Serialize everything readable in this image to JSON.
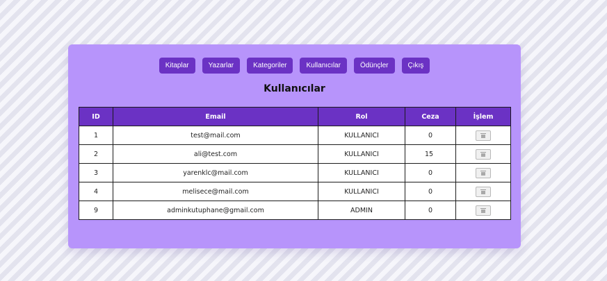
{
  "nav": {
    "buttons": [
      "Kitaplar",
      "Yazarlar",
      "Kategoriler",
      "Kullanıcılar",
      "Ödünçler",
      "Çıkış"
    ]
  },
  "page": {
    "title": "Kullanıcılar"
  },
  "table": {
    "headers": {
      "id": "ID",
      "email": "Email",
      "rol": "Rol",
      "ceza": "Ceza",
      "islem": "İşlem"
    },
    "rows": [
      {
        "id": "1",
        "email": "test@mail.com",
        "rol": "KULLANICI",
        "ceza": "0"
      },
      {
        "id": "2",
        "email": "ali@test.com",
        "rol": "KULLANICI",
        "ceza": "15"
      },
      {
        "id": "3",
        "email": "yarenklc@mail.com",
        "rol": "KULLANICI",
        "ceza": "0"
      },
      {
        "id": "4",
        "email": "melisece@mail.com",
        "rol": "KULLANICI",
        "ceza": "0"
      },
      {
        "id": "9",
        "email": "adminkutuphane@gmail.com",
        "rol": "ADMIN",
        "ceza": "0"
      }
    ],
    "action_icon": "trash-icon"
  },
  "colors": {
    "background": "#f3f3f8",
    "card": "#b794fb",
    "accent": "#6b32c4",
    "text": "#111111"
  }
}
